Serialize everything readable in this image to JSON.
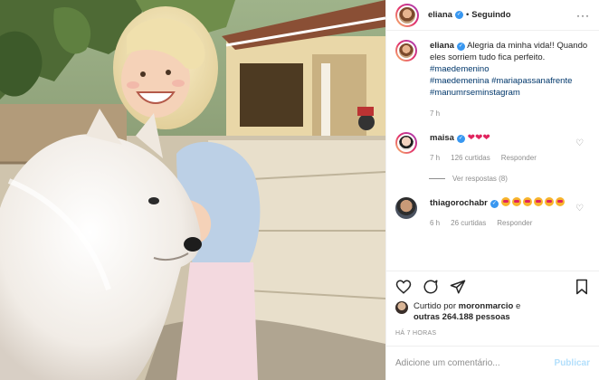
{
  "header": {
    "username": "eliana",
    "verified_icon": "verified-badge-icon",
    "separator": "•",
    "follow_state": "Seguindo",
    "menu_icon": "more-options-icon",
    "menu_glyph": "···"
  },
  "caption": {
    "username": "eliana",
    "text": "Alegria da minha vida!! Quando eles sorriem tudo fica perfeito.",
    "hashtags": [
      "#maedemenino",
      "#maedemenina",
      "#mariapassanafrente",
      "#manumrseminstagram"
    ],
    "time": "7 h"
  },
  "comments": [
    {
      "username": "maisa",
      "text_icons": "heart-emoji x3",
      "hearts": "❤❤❤",
      "time": "7 h",
      "likes": "126 curtidas",
      "reply": "Responder",
      "view_replies": "Ver respostas (8)"
    },
    {
      "username": "thiagorochabr",
      "text_icons": "heart-eyes-emoji x6",
      "time": "6 h",
      "likes": "26 curtidas",
      "reply": "Responder"
    }
  ],
  "actions": {
    "like_icon": "heart-outline-icon",
    "comment_icon": "comment-icon",
    "share_icon": "paper-plane-icon",
    "save_icon": "bookmark-icon"
  },
  "likes": {
    "prefix": "Curtido por",
    "liked_by": "moronmarcio",
    "conjunction": "e",
    "others": "outras 264.188 pessoas"
  },
  "posted_ago": "HÁ 7 HORAS",
  "add_comment": {
    "placeholder": "Adicione um comentário...",
    "publish_label": "Publicar"
  },
  "colors": {
    "link": "#00376b",
    "verified": "#3897f0",
    "muted": "#8e8e8e",
    "publish_disabled": "#b2dffc"
  }
}
